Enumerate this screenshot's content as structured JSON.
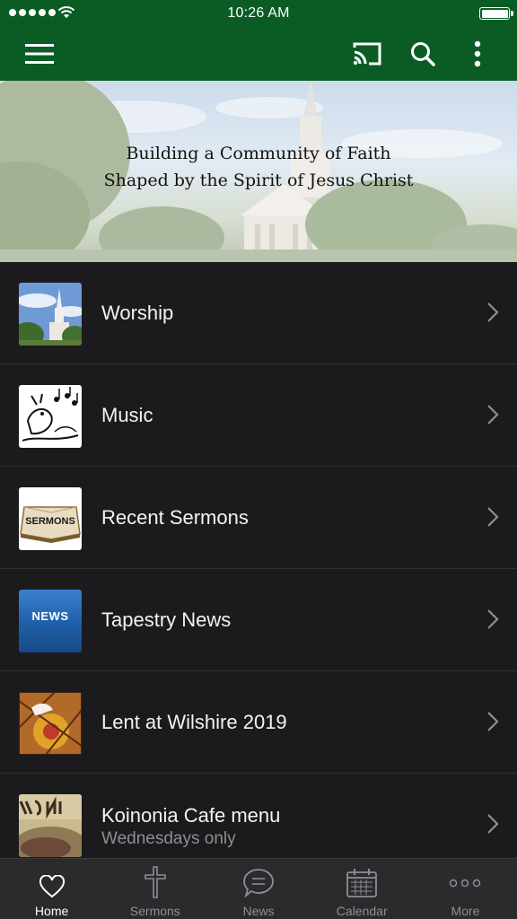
{
  "status_bar": {
    "time": "10:26 AM"
  },
  "hero": {
    "tagline_line1": "Building a Community of Faith",
    "tagline_line2": "Shaped by the Spirit of Jesus Christ"
  },
  "toolbar": {
    "menu_icon": "hamburger-menu-icon",
    "cast_icon": "cast-icon",
    "search_icon": "search-icon",
    "more_icon": "vertical-ellipsis-icon"
  },
  "list": {
    "items": [
      {
        "title": "Worship",
        "thumb": "church-steeple-photo"
      },
      {
        "title": "Music",
        "thumb": "singing-bird-drawing"
      },
      {
        "title": "Recent Sermons",
        "thumb": "sermons-book"
      },
      {
        "title": "Tapestry News",
        "thumb": "news-badge",
        "thumb_text": "NEWS"
      },
      {
        "title": "Lent at Wilshire 2019",
        "thumb": "dove-artwork"
      },
      {
        "title": "Koinonia Cafe menu",
        "subtitle": "Wednesdays only",
        "thumb": "koinonia-sign"
      }
    ],
    "sermons_thumb_text": "SERMONS"
  },
  "tab_bar": {
    "tabs": [
      {
        "label": "Home",
        "icon": "heart-icon",
        "active": true
      },
      {
        "label": "Sermons",
        "icon": "cross-icon"
      },
      {
        "label": "News",
        "icon": "speech-bubble-icon"
      },
      {
        "label": "Calendar",
        "icon": "calendar-icon"
      },
      {
        "label": "More",
        "icon": "more-dots-icon"
      }
    ]
  },
  "colors": {
    "brand_green": "#0b5c24",
    "list_bg": "#1b1b1d",
    "tab_bg": "#2b2b2e",
    "news_blue": "#1f5fa8"
  }
}
